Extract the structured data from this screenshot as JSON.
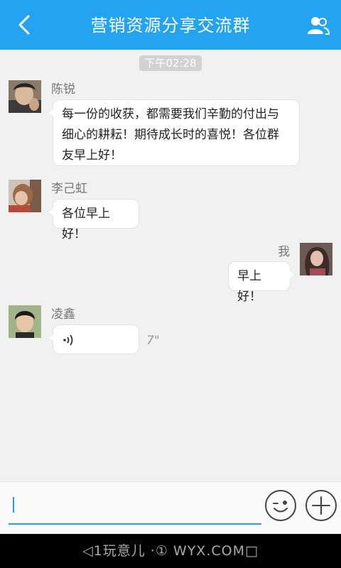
{
  "header": {
    "title": "营销资源分享交流群",
    "bg_color": "#23a3f0"
  },
  "time_separator": "下午02:28",
  "messages": [
    {
      "sender": "陈锐",
      "side": "left",
      "text": "每一份的收获，都需要我们辛勤的付出与细心的耕耘！期待成长时的喜悦！各位群友早上好！"
    },
    {
      "sender": "李己虹",
      "side": "left",
      "text": "各位早上好！"
    },
    {
      "sender": "我",
      "side": "right",
      "text": "早上好！"
    },
    {
      "sender": "凌鑫",
      "side": "left",
      "type": "voice",
      "duration": "7\""
    }
  ],
  "input": {
    "placeholder": ""
  },
  "watermark": "◁1玩意儿 ·① WYX.COM□"
}
